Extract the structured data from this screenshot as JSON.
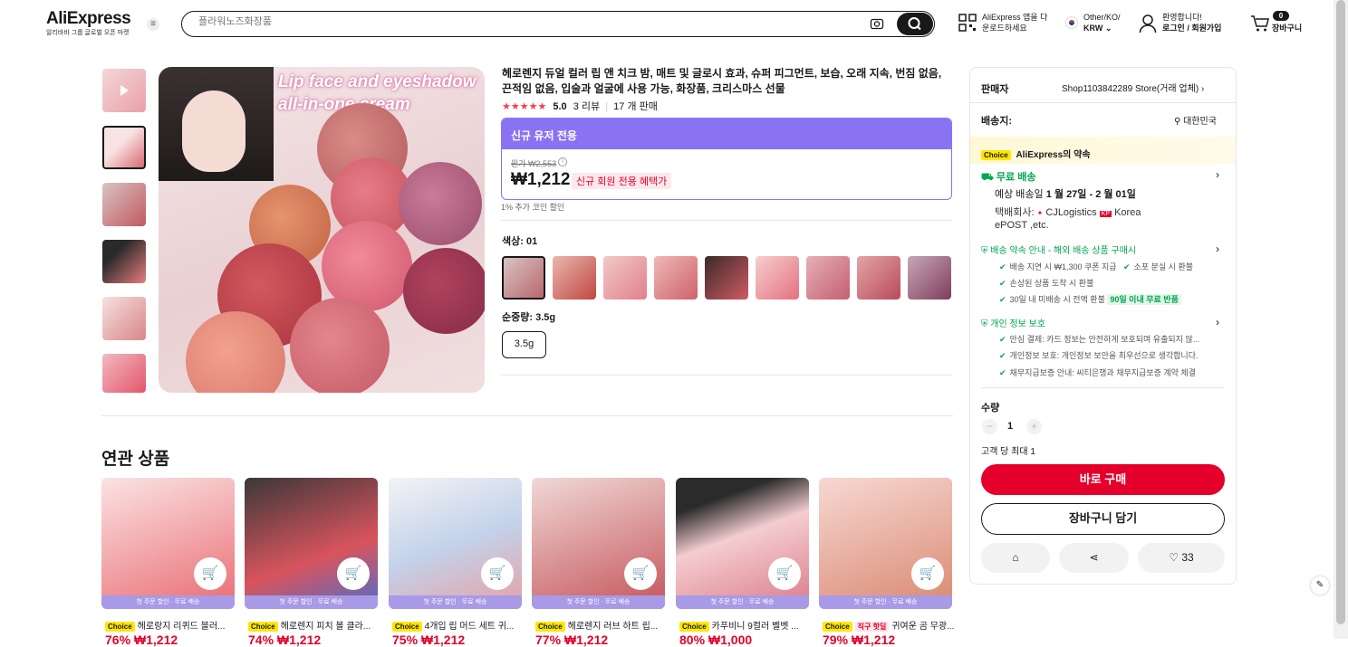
{
  "header": {
    "logo": "AliExpress",
    "logo_sub": "알리바바 그룹 글로벌 오픈 마켓",
    "search_placeholder": "플라워노즈화장품",
    "app_line1": "AliExpress 앱을 다",
    "app_line2": "운로드하세요",
    "region_line1": "Other/KO/",
    "region_line2": "KRW",
    "account_line1": "환영합니다!",
    "account_line2": "로그인 / 회원가입",
    "cart_count": "0",
    "cart_label": "장바구니"
  },
  "product": {
    "title": "헤로렌지 듀얼 컬러 립 앤 치크 밤, 매트 및 글로시 효과, 슈퍼 피그먼트, 보습, 오래 지속, 번짐 없음, 끈적임 없음, 입술과 얼굴에 사용 가능, 화장품, 크리스마스 선물",
    "rating": "5.0",
    "reviews": "3 리뷰",
    "sold": "17 개 판매",
    "image_overlay_line1": "Lip face and eyeshadow",
    "image_overlay_line2": "all-in-one cream",
    "promo_header": "신규 유저 전용",
    "orig_price_label": "원가 ₩2,553",
    "price": "₩1,212",
    "price_tag": "신규 회원 전용 혜택가",
    "coin_note": "1% 추가 코인 할인",
    "color_label": "색상: 01",
    "weight_label": "순중량: 3.5g",
    "weight_option": "3.5g"
  },
  "seller_panel": {
    "seller_label": "판매자",
    "seller_name": "Shop1103842289 Store(거래 업체)",
    "ship_to_label": "배송지:",
    "ship_to": "대한민국",
    "choice_badge": "Choice",
    "promise": "AliExpress의 약속",
    "free_shipping": "무료 배송",
    "delivery_prefix": "예상 배송일 ",
    "delivery_dates": "1 월 27일 - 2 월 01일",
    "carrier_line1": "택배회사:",
    "carrier_name": "CJLogistics",
    "carrier_korea": "Korea",
    "carrier_line2": "ePOST ,etc.",
    "guarantee_title": "배송 약속 안내 - 해외 배송 상품 구매시",
    "guarantee_1": "배송 지연 시 ₩1,300 쿠폰 지급",
    "guarantee_2": "소포 분실 시 환불",
    "guarantee_3": "손상된 상품 도착 시 환불",
    "guarantee_4": "30일 내 미배송 시 전액 환불",
    "guarantee_4_tag": "90일 이내 무료 반품",
    "privacy_title": "개인 정보 보호",
    "privacy_1": "안심 결제: 카드 정보는 안전하게 보호되며 유출되지 않...",
    "privacy_2": "개인정보 보호: 개인정보 보안을 최우선으로 생각합니다.",
    "privacy_3": "채무지급보증 안내: 씨티은행과 채무지급보증 계약 체결",
    "qty_label": "수량",
    "qty_value": "1",
    "qty_limit": "고객 당 최대 1",
    "buy_now": "바로 구매",
    "add_cart": "장바구니 담기",
    "wishlist_count": "33"
  },
  "related": {
    "title": "연관 상품",
    "band_text": "첫 주문 할인 · 무료 배송",
    "items": [
      {
        "badge": "Choice",
        "title": "헤로랑지 리퀴드 블러...",
        "price": "76% ₩1,212"
      },
      {
        "badge": "Choice",
        "title": "헤로렌지 피치 볼 클라...",
        "price": "74% ₩1,212"
      },
      {
        "badge": "Choice",
        "title": "4개입 립 머드 세트 귀...",
        "price": "75% ₩1,212"
      },
      {
        "badge": "Choice",
        "title": "헤로렌지 러브 하트 립...",
        "price": "77% ₩1,212"
      },
      {
        "badge": "Choice",
        "title": "카푸비니 9컬러 벨벳 ...",
        "price": "80% ₩1,000"
      },
      {
        "badge": "Choice",
        "badge2": "직구 핫딜",
        "title": "귀여운 곰 무광...",
        "price": "79% ₩1,212"
      }
    ]
  }
}
